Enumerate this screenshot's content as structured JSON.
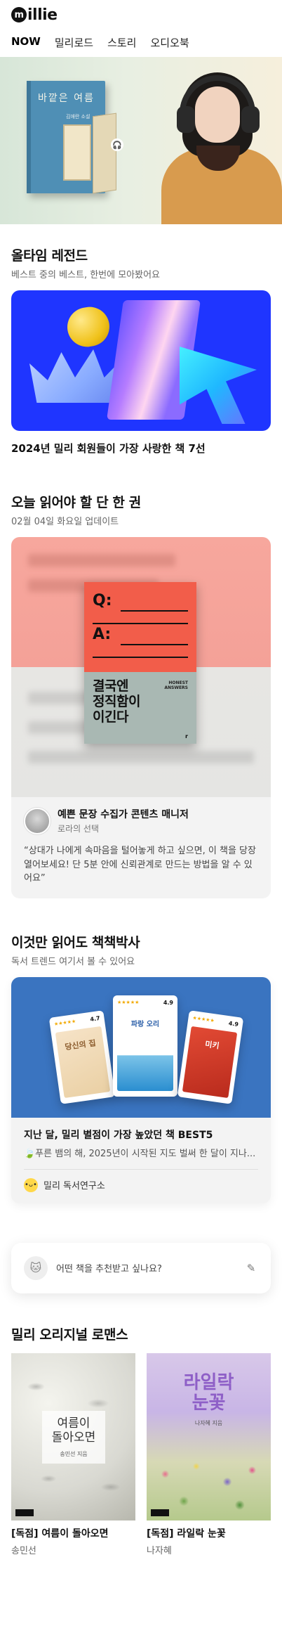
{
  "header": {
    "logo_mark": "m",
    "logo_text": "illie"
  },
  "tabs": [
    {
      "label": "NOW",
      "active": true
    },
    {
      "label": "밀리로드",
      "active": false
    },
    {
      "label": "스토리",
      "active": false
    },
    {
      "label": "오디오북",
      "active": false
    }
  ],
  "hero": {
    "book_title": "바깥은 여름",
    "book_author": "김애란 소설",
    "audio_icon": "headphones-icon"
  },
  "legends": {
    "title": "올타임 레전드",
    "subtitle": "베스트 중의 베스트, 한번에 모아봤어요",
    "caption": "2024년 밀리 회원들이 가장 사랑한 책 7선"
  },
  "today": {
    "title": "오늘 읽어야 할 단 한 권",
    "subtitle": "02월 04일 화요일 업데이트",
    "book": {
      "q": "Q:",
      "a": "A:",
      "title_line1": "결국엔",
      "title_line2": "정직함이",
      "title_line3": "이긴다",
      "en_line1": "HONEST",
      "en_line2": "ANSWERS",
      "logo": "r"
    },
    "curator": {
      "name": "예쁜 문장 수집가 콘텐츠 매니저",
      "role": "로라의 선택",
      "quote": "“상대가 나에게 속마음을 털어놓게 하고 싶으면, 이 책을 당장 열어보세요! 단 5분 안에 신뢰관계로 만드는 방법을 알 수 있어요”"
    }
  },
  "doctor": {
    "title": "이것만 읽어도 책책박사",
    "subtitle": "독서 트렌드 여기서 볼 수 있어요",
    "books": [
      {
        "rating": "4.7",
        "cover_title": "당신의 집"
      },
      {
        "rating": "4.9",
        "cover_title": "파랑 오리"
      },
      {
        "rating": "4.9",
        "cover_title": "미키"
      }
    ],
    "card_title": "지난 달, 밀리 별점이 가장 높았던 책 BEST5",
    "card_desc": "🍃푸른 뱀의 해, 2025년이 시작된 지도 벌써 한 달이 지나...",
    "author": "밀리 독서연구소"
  },
  "ask": {
    "placeholder": "어떤 책을 추천받고 싶나요?"
  },
  "romance": {
    "title": "밀리 오리지널 로맨스",
    "items": [
      {
        "cover_title_1": "여름이",
        "cover_title_2": "돌아오면",
        "cover_author": "송민선 지음",
        "title": "[독점] 여름이 돌아오면",
        "author": "송민선"
      },
      {
        "cover_title_1": "라일락",
        "cover_title_2": "눈꽃",
        "cover_author": "나자혜 지음",
        "title": "[독점] 라일락 눈꽃",
        "author": "나자혜"
      }
    ]
  }
}
